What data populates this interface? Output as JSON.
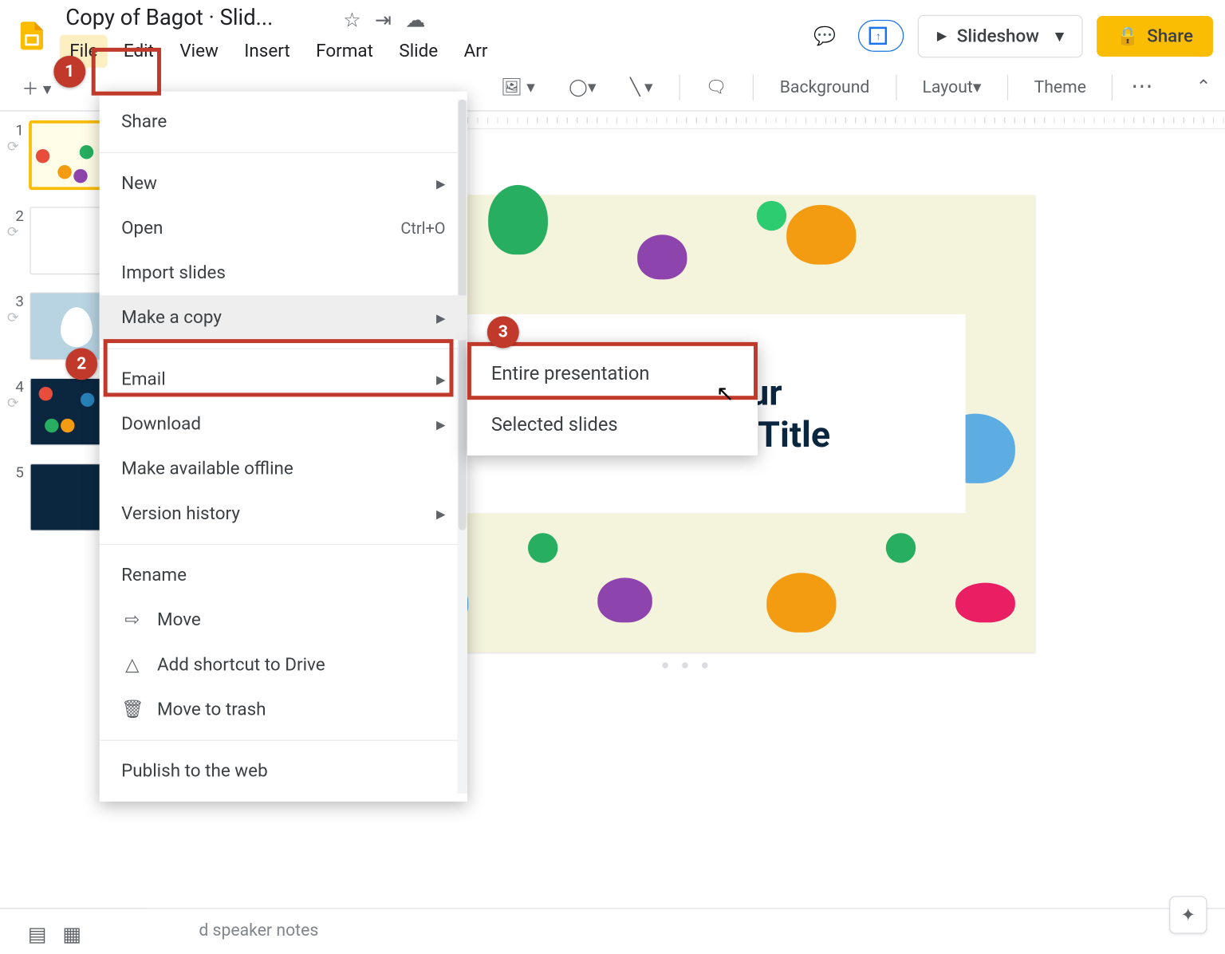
{
  "header": {
    "doc_title": "Copy of Bagot · Slid...",
    "star_icon": "star-icon",
    "move_icon": "move-icon",
    "cloud_icon": "cloud-status-icon"
  },
  "menubar": [
    "File",
    "Edit",
    "View",
    "Insert",
    "Format",
    "Slide",
    "Arr"
  ],
  "right": {
    "slideshow": "Slideshow",
    "share": "Share"
  },
  "toolbar": {
    "background": "Background",
    "layout": "Layout",
    "theme": "Theme"
  },
  "file_menu": {
    "share": "Share",
    "new": "New",
    "open": "Open",
    "open_shortcut": "Ctrl+O",
    "import": "Import slides",
    "make_copy": "Make a copy",
    "email": "Email",
    "download": "Download",
    "offline": "Make available offline",
    "version": "Version history",
    "rename": "Rename",
    "move": "Move",
    "shortcut": "Add shortcut to Drive",
    "trash": "Move to trash",
    "publish": "Publish to the web"
  },
  "submenu": {
    "entire": "Entire presentation",
    "selected": "Selected slides"
  },
  "slide": {
    "title_l1": "This is Your",
    "title_l2": "Presentation Title"
  },
  "notes_placeholder": "d speaker notes",
  "thumbs": [
    1,
    2,
    3,
    4,
    5
  ],
  "badges": {
    "one": "1",
    "two": "2",
    "three": "3"
  }
}
